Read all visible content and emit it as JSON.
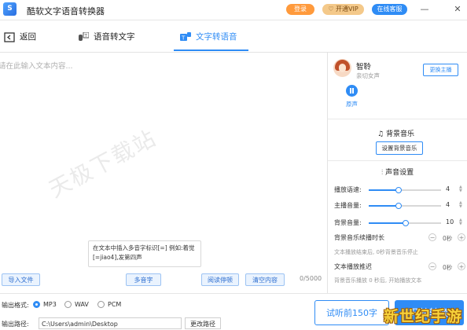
{
  "app": {
    "logo_char": "S",
    "title": "酷软文字语音转换器"
  },
  "titlebar": {
    "login": "登录",
    "vip": "♡ 开通VIP",
    "service": "在线客服",
    "minimize": "—",
    "close": "✕"
  },
  "nav": {
    "back": "返回",
    "tab_speech_to_text": "语音转文字",
    "tab_text_to_speech": "文字转语音"
  },
  "editor": {
    "placeholder": "请在此输入文本内容...",
    "watermark": "天极下载站",
    "tooltip": "在文本中插入多音字标识[=] 例如:着觉[=jiao4],发第四声",
    "counter": "0/5000",
    "buttons": {
      "import": "导入文件",
      "polyphone": "多音字",
      "read_pause": "阅读停顿",
      "clear": "清空内容"
    }
  },
  "voice": {
    "name": "智聆",
    "desc": "亲切女声",
    "change": "更换主播",
    "preview": "原声"
  },
  "bgm": {
    "title": "背景音乐",
    "set_button": "设置背景音乐"
  },
  "sound": {
    "title": "声音设置",
    "rows": [
      {
        "label": "播放语速:",
        "value": "4",
        "level": 0.4
      },
      {
        "label": "主播音量:",
        "value": "4",
        "level": 0.4
      },
      {
        "label": "背景音量:",
        "value": "10",
        "level": 0.5
      }
    ],
    "bgm_delay": {
      "label": "背景音乐续播时长",
      "value": "0秒",
      "note": "文本播放结束后, 0秒背景音乐停止"
    },
    "text_delay": {
      "label": "文本播放推迟",
      "value": "0秒",
      "note": "背景音乐播放 0 秒后, 开始播放文本"
    },
    "minus": "−",
    "plus": "+"
  },
  "output": {
    "format_label": "输出格式:",
    "formats": [
      "MP3",
      "WAV",
      "PCM"
    ],
    "selected": "MP3",
    "path_label": "输出路径:",
    "path": "C:\\Users\\admin\\Desktop",
    "change_path": "更改路径",
    "try_button": "试听前150字",
    "start_button": "开始转换"
  },
  "overlay_watermark": "新世纪手游",
  "colors": {
    "accent": "#2f8cf5",
    "login": "#ff9a3c",
    "vip": "#f4c98a"
  }
}
